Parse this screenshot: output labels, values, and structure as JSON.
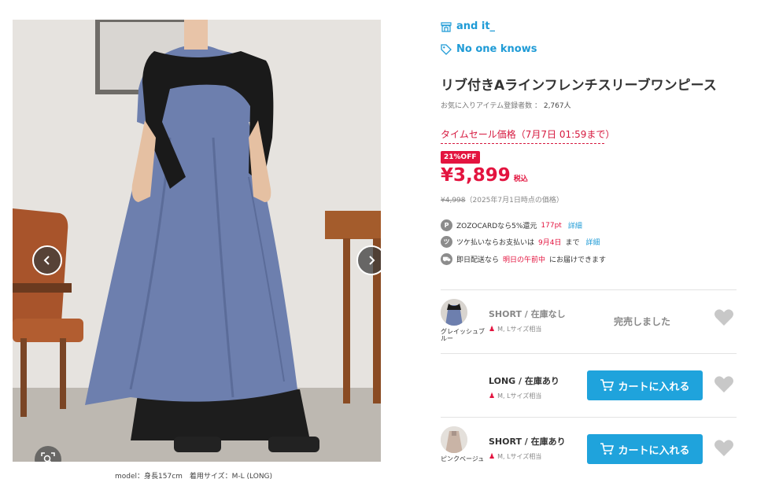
{
  "image": {
    "model_caption": "model：身長157cm　着用サイズ：M-L (LONG)"
  },
  "product": {
    "brand": "and it_",
    "tag": "No one knows",
    "title": "リブ付きAラインフレンチスリーブワンピース",
    "favorites_label": "お気に入りアイテム登録者数 ：",
    "favorites_count": "2,767人",
    "sale_label": "タイムセール価格（7月7日 01:59まで）",
    "discount_badge": "21%OFF",
    "price": "¥3,899",
    "tax_label": "税込",
    "original_price": "¥4,998",
    "original_price_note": "（2025年7月1日時点の価格）"
  },
  "perks": [
    {
      "icon": "P",
      "icon_name": "points-icon",
      "text_a": "ZOZOCARDなら5%還元",
      "highlight": "177pt",
      "text_b": "",
      "detail": "詳細"
    },
    {
      "icon": "ツ",
      "icon_name": "deferred-payment-icon",
      "text_a": "ツケ払いならお支払いは",
      "highlight": "9月4日",
      "text_b": "まで",
      "detail": "詳細"
    },
    {
      "icon": "⛟",
      "icon_name": "delivery-truck-icon",
      "text_a": "即日配送なら",
      "highlight": "明日の午前中",
      "text_b": "にお届けできます",
      "detail": ""
    }
  ],
  "skus": [
    {
      "color": "グレイッシュブルー",
      "size_stock": "SHORT / 在庫なし",
      "fit": "M, Lサイズ相当",
      "status": "完売しました",
      "cart_label": ""
    },
    {
      "color": "",
      "size_stock": "LONG / 在庫あり",
      "fit": "M, Lサイズ相当",
      "status": "",
      "cart_label": "カートに入れる"
    },
    {
      "color": "ピンクベージュ",
      "size_stock": "SHORT / 在庫あり",
      "fit": "M, Lサイズ相当",
      "status": "",
      "cart_label": "カートに入れる"
    }
  ],
  "colors": {
    "accent_blue": "#1f9bd6",
    "sale_red": "#e3143f",
    "cart_button": "#1fa3dc"
  }
}
